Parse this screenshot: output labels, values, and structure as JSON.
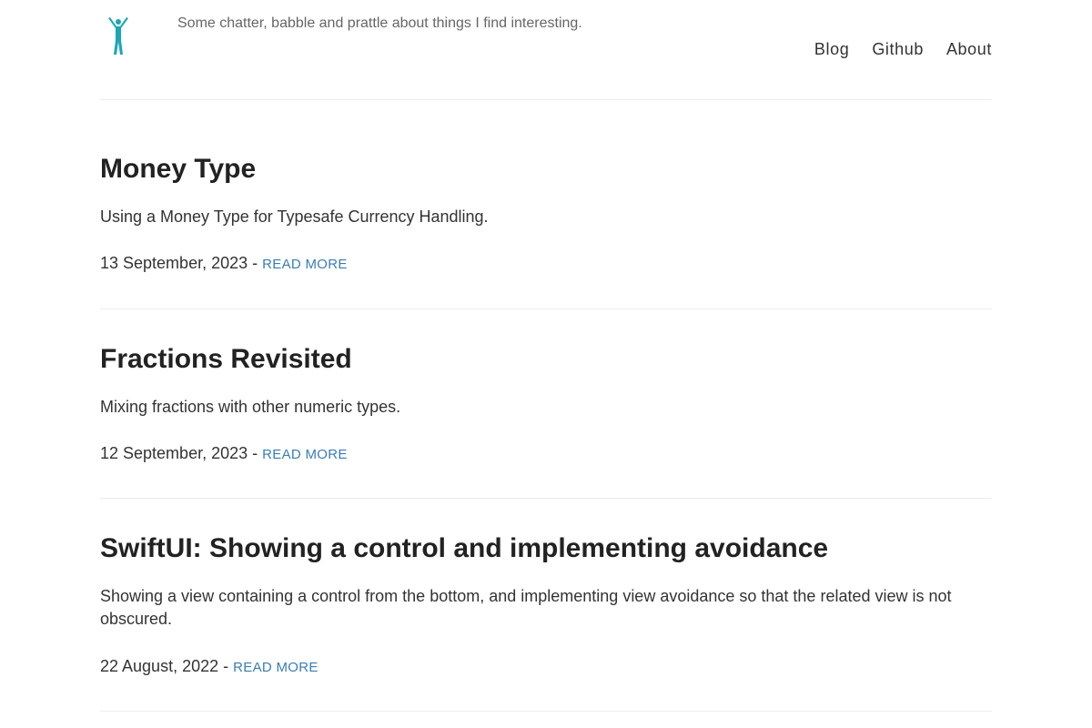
{
  "header": {
    "tagline": "Some chatter, babble and prattle about things I find interesting.",
    "logo_icon": "person-raising-arms-icon",
    "logo_color": "#1aa6b7"
  },
  "nav": {
    "items": [
      {
        "label": "Blog"
      },
      {
        "label": "Github"
      },
      {
        "label": "About"
      }
    ]
  },
  "posts": [
    {
      "title": "Money Type",
      "summary": "Using a Money Type for Typesafe Currency Handling.",
      "date": "13 September, 2023",
      "separator": "-",
      "read_more": "READ MORE"
    },
    {
      "title": "Fractions Revisited",
      "summary": "Mixing fractions with other numeric types.",
      "date": "12 September, 2023",
      "separator": "-",
      "read_more": "READ MORE"
    },
    {
      "title": "SwiftUI: Showing a control and implementing avoidance",
      "summary": "Showing a view containing a control from the bottom, and implementing view avoidance so that the related view is not obscured.",
      "date": "22 August, 2022",
      "separator": "-",
      "read_more": "READ MORE"
    }
  ],
  "colors": {
    "link": "#3a7db5",
    "divider": "#ececec",
    "text": "#222222"
  }
}
